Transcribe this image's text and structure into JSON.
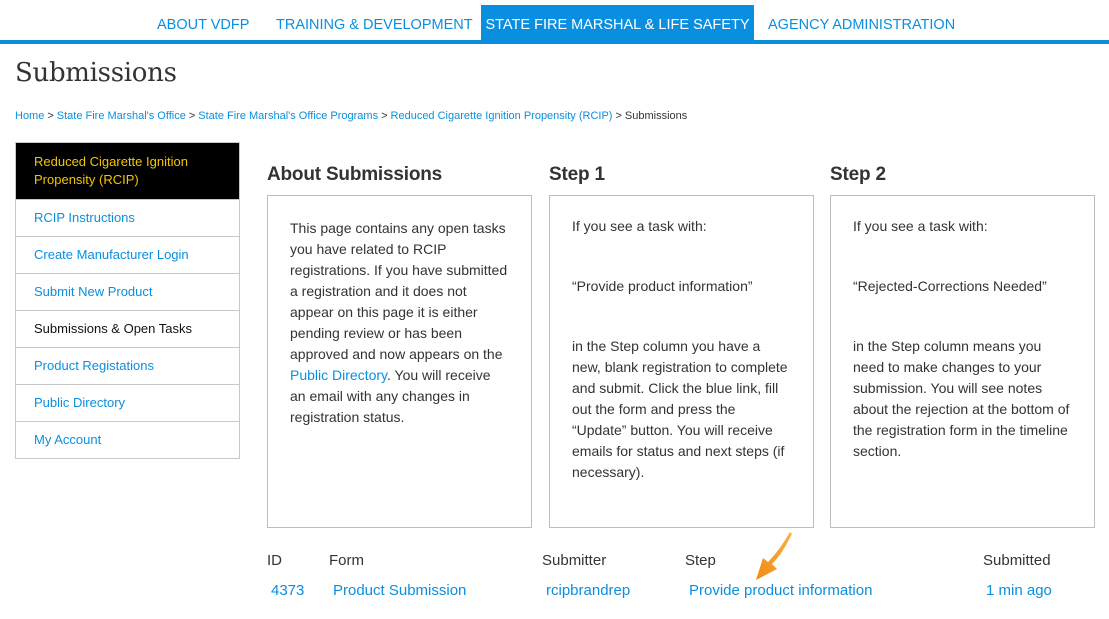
{
  "topnav": {
    "items": [
      {
        "label": "ABOUT VDFP",
        "active": false
      },
      {
        "label": "TRAINING & DEVELOPMENT",
        "active": false
      },
      {
        "label": "STATE FIRE MARSHAL & LIFE SAFETY",
        "active": true
      },
      {
        "label": "AGENCY ADMINISTRATION",
        "active": false
      }
    ]
  },
  "page": {
    "title": "Submissions"
  },
  "breadcrumb": {
    "separator": ">",
    "items": [
      {
        "label": "Home",
        "link": true
      },
      {
        "label": "State Fire Marshal's Office",
        "link": true
      },
      {
        "label": "State Fire Marshal's Office Programs",
        "link": true
      },
      {
        "label": "Reduced Cigarette Ignition Propensity (RCIP)",
        "link": true
      },
      {
        "label": "Submissions",
        "link": false
      }
    ]
  },
  "sidebar": {
    "header": "Reduced Cigarette Ignition Propensity (RCIP)",
    "items": [
      {
        "label": "RCIP Instructions",
        "current": false
      },
      {
        "label": "Create Manufacturer Login",
        "current": false
      },
      {
        "label": "Submit New Product",
        "current": false
      },
      {
        "label": "Submissions & Open Tasks",
        "current": true
      },
      {
        "label": "Product Registations",
        "current": false
      },
      {
        "label": "Public Directory",
        "current": false
      },
      {
        "label": "My Account",
        "current": false
      }
    ]
  },
  "columns": {
    "about": {
      "title": "About Submissions",
      "text_before": "This page contains any open tasks you have related to RCIP registrations.  If you have submitted a registration and it does not appear on this page it is either pending review or has been approved and now appears on the ",
      "link": "Public Directory",
      "text_after": ".  You will receive an email with any changes in registration status."
    },
    "step1": {
      "title": "Step 1",
      "intro": "If you see a task with:",
      "quote": "“Provide product information”",
      "body": "in the Step column you have a new, blank registration to complete and submit.  Click the blue link, fill out the form and press the “Update” button.  You will receive emails for status and next steps (if necessary)."
    },
    "step2": {
      "title": "Step 2",
      "intro": "If you see a task with:",
      "quote": "“Rejected-Corrections Needed”",
      "body": "in the Step column means you need to make changes to your submission.  You will see notes about the rejection at the bottom of the registration form in the timeline section."
    }
  },
  "tasks": {
    "headers": {
      "id": "ID",
      "form": "Form",
      "submitter": "Submitter",
      "step": "Step",
      "submitted": "Submitted"
    },
    "rows": [
      {
        "id": "4373",
        "form": "Product Submission",
        "submitter": "rcipbrandrep",
        "step": "Provide product information",
        "submitted": "1 min ago"
      }
    ]
  },
  "annotation": {
    "icon": "arrow-pointer-icon",
    "color": "#f7941d"
  },
  "colors": {
    "accent": "#0a8fe0",
    "sidebar_header_bg": "#000000",
    "sidebar_header_text": "#f5c400"
  }
}
